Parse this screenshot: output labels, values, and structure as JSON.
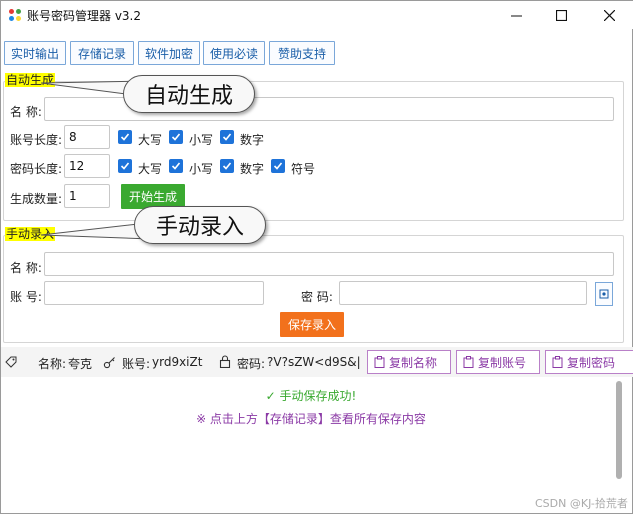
{
  "window": {
    "title": "账号密码管理器 v3.2",
    "minimize": "—",
    "maximize": "☐",
    "close": "✕"
  },
  "toolbar": {
    "buttons": [
      "实时输出",
      "存储记录",
      "软件加密",
      "使用必读",
      "赞助支持"
    ]
  },
  "auto": {
    "legend": "自动生成",
    "callout": "自动生成",
    "name_label": "名 称:",
    "name_value": "",
    "account_len_label": "账号长度:",
    "account_len_value": "8",
    "account_opts": [
      "大写",
      "小写",
      "数字"
    ],
    "password_len_label": "密码长度:",
    "password_len_value": "12",
    "password_opts": [
      "大写",
      "小写",
      "数字",
      "符号"
    ],
    "count_label": "生成数量:",
    "count_value": "1",
    "generate_button": "开始生成"
  },
  "manual": {
    "legend": "手动录入",
    "callout": "手动录入",
    "name_label": "名 称:",
    "name_value": "",
    "account_label": "账 号:",
    "account_value": "",
    "password_label": "密 码:",
    "password_value": "",
    "save_button": "保存录入"
  },
  "status": {
    "name_label": "名称:",
    "name_value": "夸克",
    "account_label": "账号:",
    "account_value": "yrd9xiZt",
    "password_label": "密码:",
    "password_value": "?V?sZW<d9S&|",
    "copy_name": "复制名称",
    "copy_account": "复制账号",
    "copy_password": "复制密码"
  },
  "messages": {
    "success": "手动保存成功!",
    "tip": "※ 点击上方【存储记录】查看所有保存内容"
  },
  "watermark": "CSDN @KJ-拾荒者",
  "colors": {
    "accent": "#1e73d9",
    "green": "#3aa930",
    "orange": "#f2711c",
    "purple": "#8b3aa6",
    "highlight": "#ffff00"
  }
}
